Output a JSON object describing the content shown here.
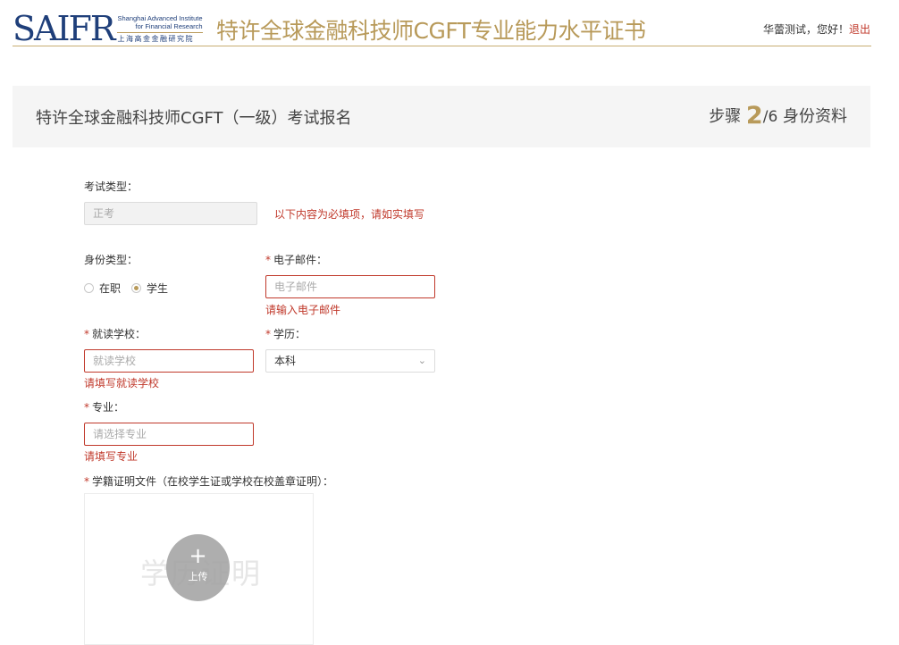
{
  "header": {
    "logo_mark": "SAIFR",
    "logo_en_line1": "Shanghai Advanced Institute",
    "logo_en_line2": "for Financial Research",
    "logo_cn": "上海高金金融研究院",
    "site_title": "特许全球金融科技师CGFT专业能力水平证书",
    "greeting": "华蕾测试，您好！",
    "logout_label": "退出"
  },
  "title_bar": {
    "exam_title": "特许全球金融科技师CGFT（一级）考试报名",
    "step_prefix": "步骤",
    "step_current": "2",
    "step_total": "/6",
    "step_name": "身份资料"
  },
  "form": {
    "exam_type": {
      "label": "考试类型：",
      "value": "正考"
    },
    "notice": "以下内容为必填项，请如实填写",
    "identity": {
      "label": "身份类型：",
      "options": [
        "在职",
        "学生"
      ],
      "selected": "学生"
    },
    "email": {
      "label": "电子邮件：",
      "placeholder": "电子邮件",
      "error": "请输入电子邮件"
    },
    "school": {
      "label": "就读学校：",
      "placeholder": "就读学校",
      "error": "请填写就读学校"
    },
    "education": {
      "label": "学历：",
      "value": "本科"
    },
    "major": {
      "label": "专业：",
      "placeholder": "请选择专业",
      "error": "请填写专业"
    },
    "proof": {
      "label": "学籍证明文件（在校学生证或学校在校盖章证明）：",
      "watermark": "学历证明",
      "upload_label": "上传"
    },
    "required_mark": "*"
  },
  "colors": {
    "accent": "#b89a5a",
    "error": "#c0392b",
    "logo_blue": "#1f3f7a"
  }
}
